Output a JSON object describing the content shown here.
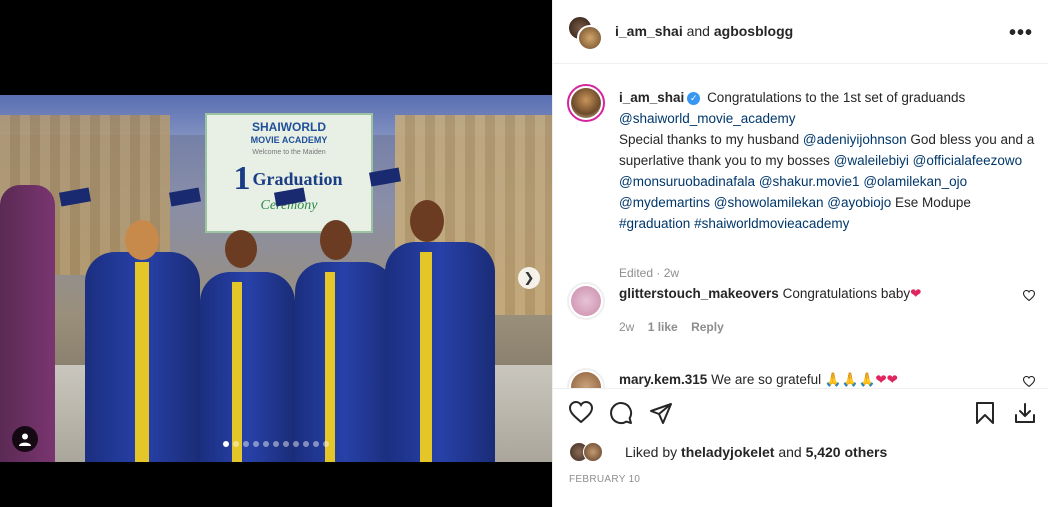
{
  "post": {
    "banner": {
      "logo_line1": "SHAIWORLD",
      "logo_line2": "MOVIE ACADEMY",
      "subtitle": "Welcome to the Maiden",
      "number": "1",
      "headline": "Graduation",
      "script": "Ceremony"
    },
    "carousel": {
      "total": 11,
      "active": 0
    }
  },
  "header": {
    "author": "i_am_shai",
    "joiner": "and",
    "coauthor": "agbosblogg",
    "more_label": "•••"
  },
  "caption": {
    "username": "i_am_shai",
    "verified": "✓",
    "line1": "Congratulations to the 1st set of graduands",
    "mention_academy": "@shaiworld_movie_academy",
    "text2": "Special thanks to my husband",
    "mention_husband": "@adeniyijohnson",
    "text3": "God bless you and a superlative thank you to my bosses",
    "m1": "@waleilebiyi",
    "m2": "@officialafeezowo",
    "m3": "@monsuruobadinafala",
    "m4": "@shakur.movie1",
    "m5": "@olamilekan_ojo",
    "m6": "@mydemartins",
    "m7": "@showolamilekan",
    "m8": "@ayobiojo",
    "text4": "Ese Modupe",
    "tag1": "#graduation",
    "tag2": "#shaiworldmovieacademy",
    "edited": "Edited · 2w"
  },
  "comments": [
    {
      "username": "glitterstouch_makeovers",
      "text": "Congratulations baby",
      "emoji": "❤",
      "age": "2w",
      "likes": "1 like",
      "reply": "Reply"
    },
    {
      "username": "mary.kem.315",
      "text": "We are so grateful",
      "emoji": "🙏🙏🙏❤❤"
    }
  ],
  "likes": {
    "prefix": "Liked by",
    "user": "theladyjokelet",
    "joiner": "and",
    "count": "5,420 others"
  },
  "date": "FEBRUARY 10",
  "colors": {
    "link": "#00376b",
    "muted": "#8e8e8e",
    "heart": "#e0245e",
    "verified": "#3897f0"
  }
}
